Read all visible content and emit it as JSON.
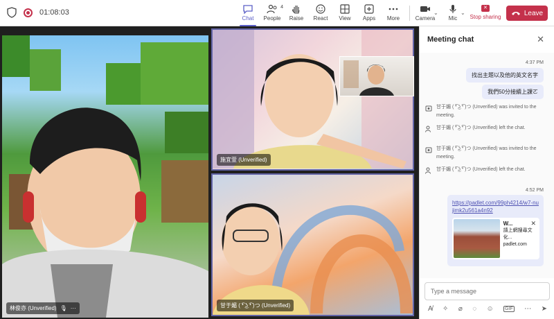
{
  "header": {
    "timer": "01:08:03",
    "buttons": [
      {
        "label": "Chat",
        "icon": "chat-icon"
      },
      {
        "label": "People",
        "icon": "people-icon",
        "count": "4"
      },
      {
        "label": "Raise",
        "icon": "raise-hand-icon"
      },
      {
        "label": "React",
        "icon": "react-icon"
      },
      {
        "label": "View",
        "icon": "view-icon"
      },
      {
        "label": "Apps",
        "icon": "apps-icon"
      },
      {
        "label": "More",
        "icon": "more-icon"
      },
      {
        "label": "Camera",
        "icon": "camera-icon"
      },
      {
        "label": "Mic",
        "icon": "mic-icon"
      }
    ],
    "stop_sharing": "Stop sharing",
    "leave": "Leave"
  },
  "stage": {
    "tiles": [
      {
        "name": "林俊亦 (Unverified)"
      },
      {
        "name": "施宜萱 (Unverified)"
      },
      {
        "name": "甘于媚 ( ͡❛ ͜ʖ ͡❛ )つ (Unverified)"
      }
    ]
  },
  "chat": {
    "title": "Meeting chat",
    "messages": [
      {
        "time": "4:37 PM"
      },
      {
        "text": "找出主題以及他的英文名字"
      },
      {
        "text": "我們50分接續上課ㄛ"
      }
    ],
    "system": [
      "甘于媚 ( ͡❛ ͜ʖ ͡❛ )つ (Unverified) was invited to the meeting.",
      "甘于媚 ( ͡❛ ͜ʖ ͡❛ )つ (Unverified) left the chat.",
      "甘于媚 ( ͡❛ ͜ʖ ͡❛ )つ (Unverified) was invited to the meeting.",
      "甘于媚 ( ͡❛ ͜ʖ ͡❛ )つ (Unverified) left the chat."
    ],
    "link_time": "4:52 PM",
    "link_url": "https://padlet.com/99ph4214/w7-nujimk2u561a4n92",
    "card": {
      "title": "W...",
      "desc": "請上網搜尋文化...",
      "domain": "padlet.com"
    },
    "compose_placeholder": "Type a message"
  },
  "colors": {
    "accent": "#5b5fc7",
    "leave": "#c4314b"
  }
}
